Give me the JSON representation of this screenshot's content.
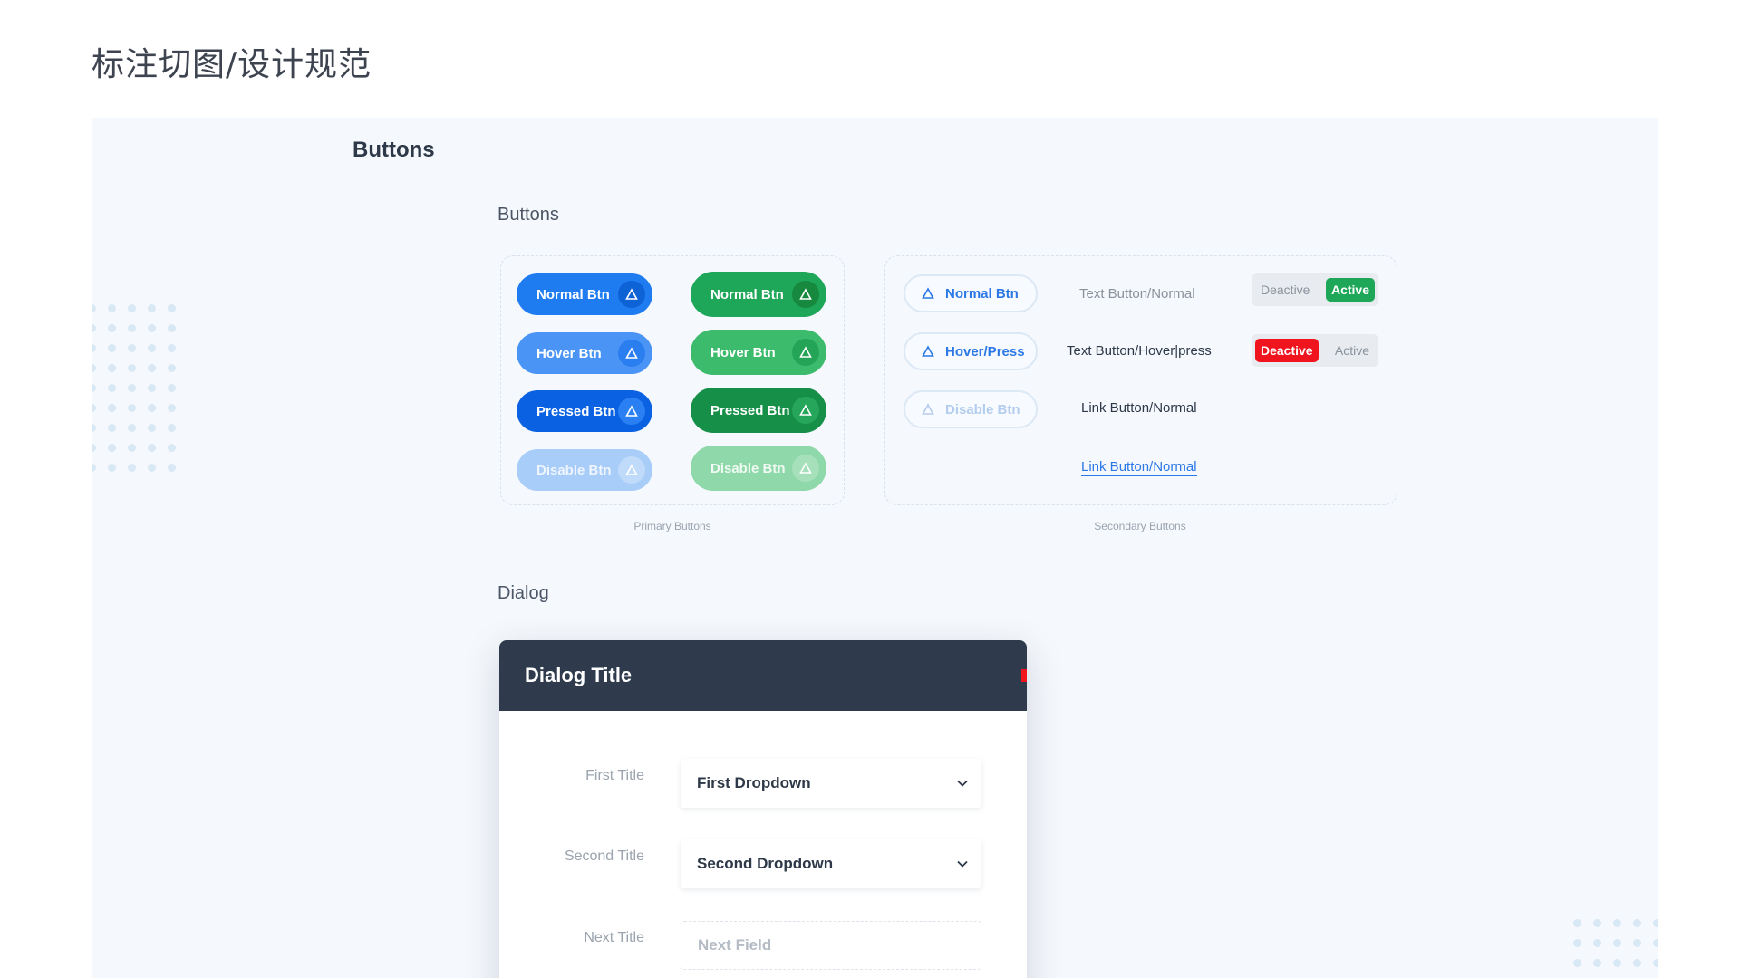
{
  "page": {
    "title": "标注切图/设计规范"
  },
  "section": {
    "title": "Buttons"
  },
  "buttons_group": {
    "title": "Buttons"
  },
  "primary": {
    "caption": "Primary Buttons",
    "blue": [
      "Normal Btn",
      "Hover Btn",
      "Pressed Btn",
      "Disable Btn"
    ],
    "green": [
      "Normal Btn",
      "Hover Btn",
      "Pressed Btn",
      "Disable Btn"
    ]
  },
  "secondary": {
    "caption": "Secondary Buttons",
    "outline": [
      "Normal Btn",
      "Hover/Press",
      "Disable Btn"
    ],
    "text_normal": "Text Button/Normal",
    "text_hover": "Text Button/Hover|press",
    "link_normal": "Link Button/Normal",
    "link_active": "Link Button/Normal",
    "toggle1": {
      "deactive": "Deactive",
      "active": "Active"
    },
    "toggle2": {
      "deactive": "Deactive",
      "active": "Active"
    }
  },
  "dialog_group": {
    "title": "Dialog"
  },
  "dialog": {
    "title": "Dialog Title",
    "rows": [
      {
        "label": "First Title",
        "value": "First Dropdown"
      },
      {
        "label": "Second Title",
        "value": "Second Dropdown"
      },
      {
        "label": "Next Title",
        "placeholder": "Next Field"
      }
    ]
  },
  "colors": {
    "primary_blue": "#1f7bf0",
    "primary_green": "#1ea659",
    "danger_red": "#f0141e",
    "dialog_header": "#2f3b4d",
    "panel_bg": "#f5f8fc"
  },
  "icons": {
    "button_icon": "triangle-icon",
    "dropdown_icon": "chevron-down-icon"
  }
}
